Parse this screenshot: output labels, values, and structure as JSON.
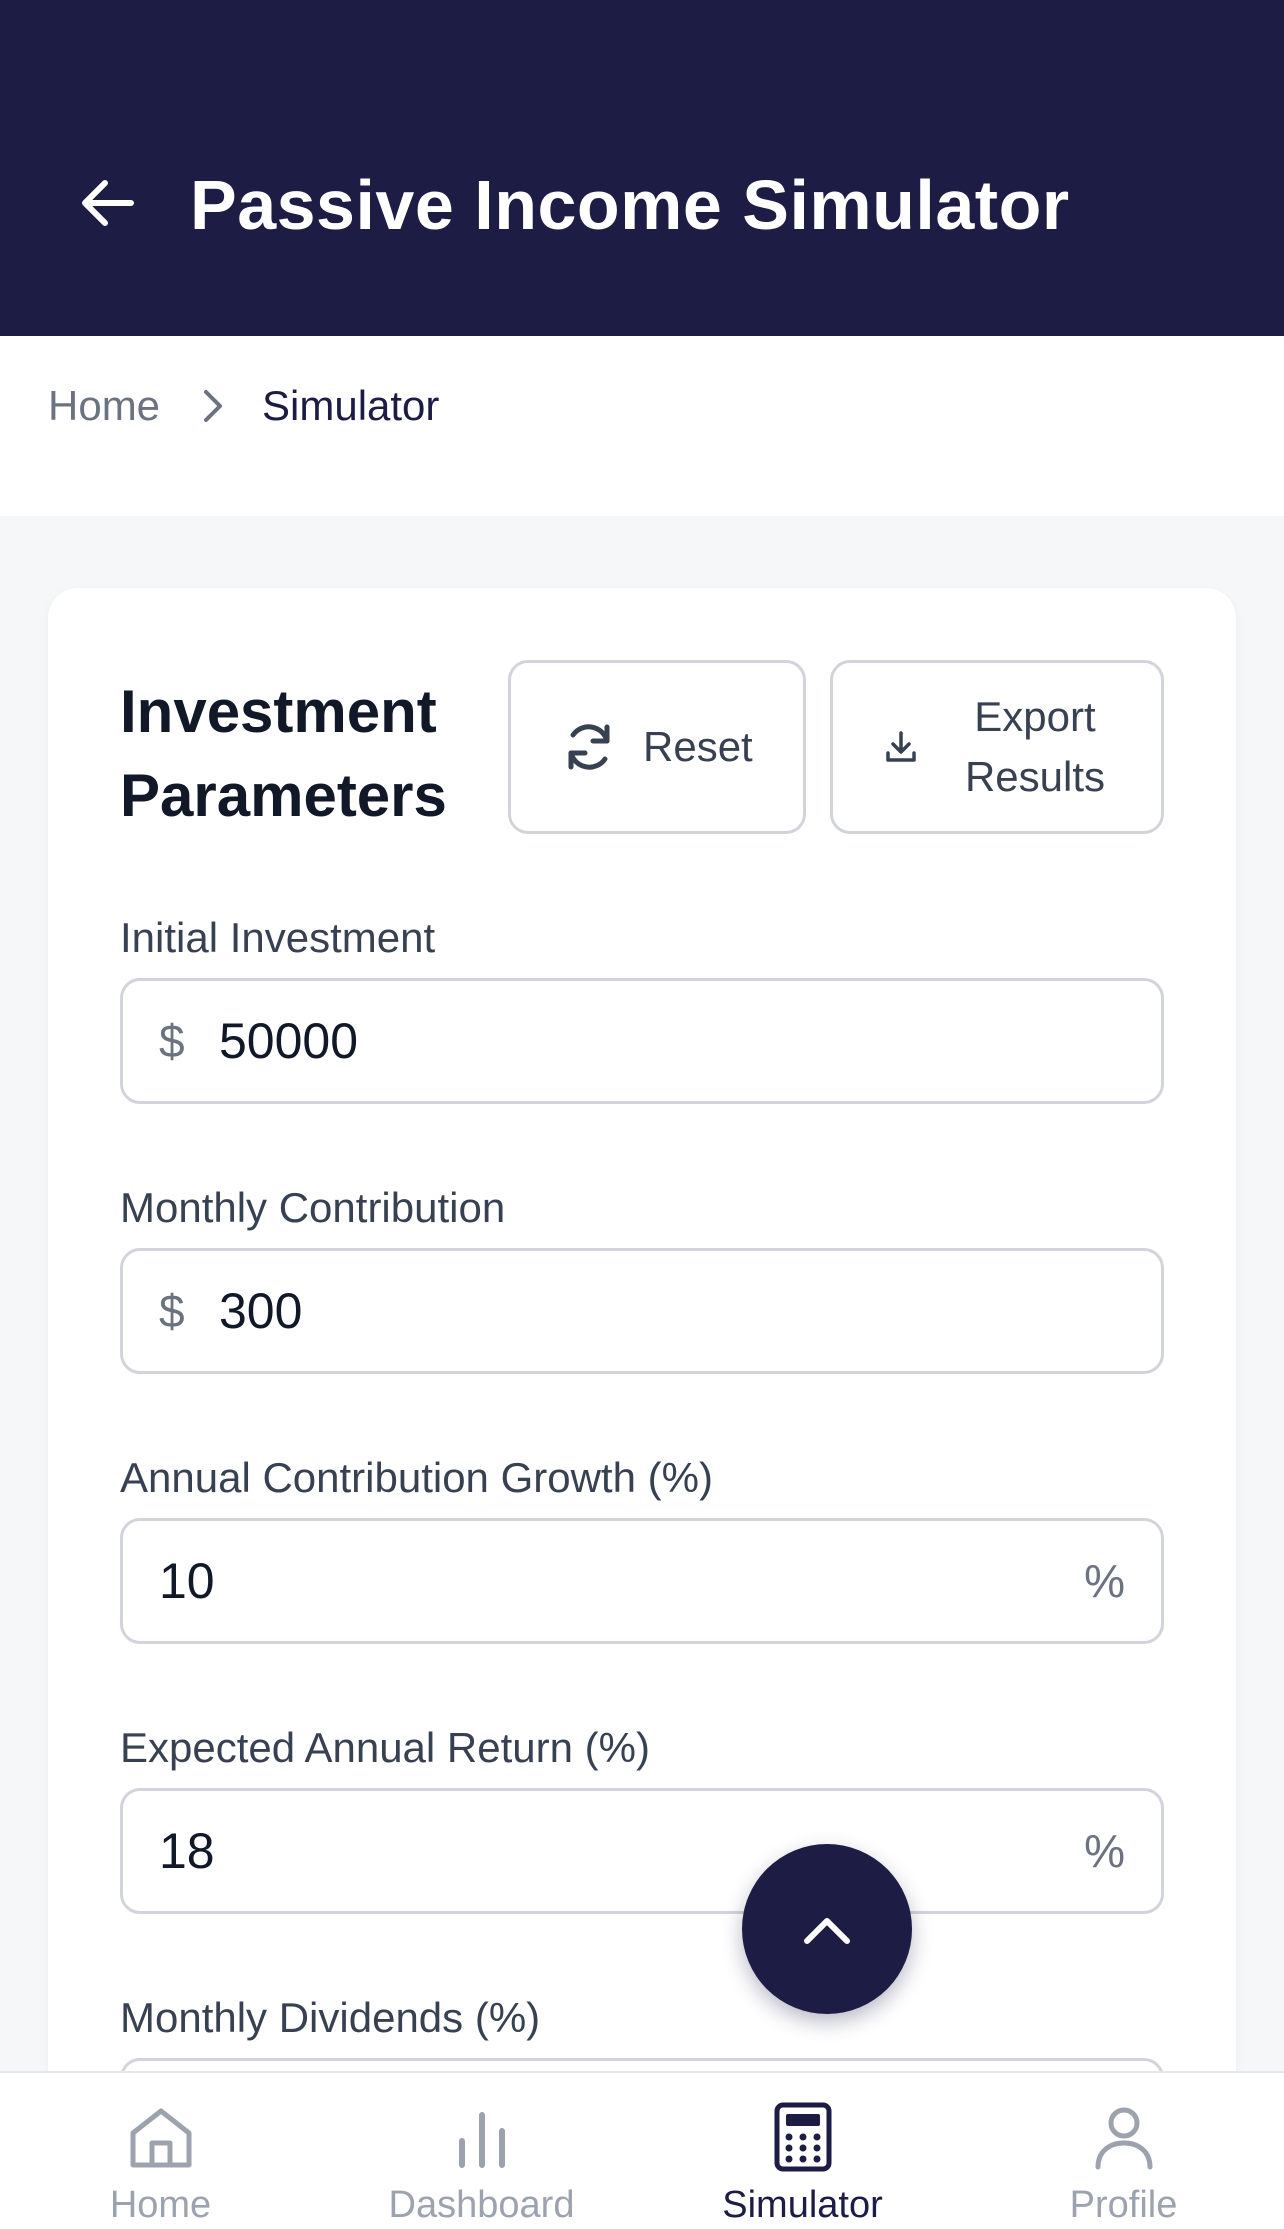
{
  "header": {
    "title": "Passive Income Simulator"
  },
  "breadcrumb": {
    "home": "Home",
    "current": "Simulator"
  },
  "card": {
    "title": "Investment Parameters",
    "reset_label": "Reset",
    "export_label": "Export Results"
  },
  "fields": {
    "initial_investment": {
      "label": "Initial Investment",
      "prefix": "$",
      "value": "50000"
    },
    "monthly_contribution": {
      "label": "Monthly Contribution",
      "prefix": "$",
      "value": "300"
    },
    "annual_growth": {
      "label": "Annual Contribution Growth (%)",
      "suffix": "%",
      "value": "10"
    },
    "annual_return": {
      "label": "Expected Annual Return (%)",
      "suffix": "%",
      "value": "18"
    },
    "monthly_dividends": {
      "label": "Monthly Dividends (%)"
    }
  },
  "bottom_nav": {
    "items": [
      {
        "label": "Home",
        "icon": "home-icon"
      },
      {
        "label": "Dashboard",
        "icon": "bar-chart-icon"
      },
      {
        "label": "Simulator",
        "icon": "calculator-icon",
        "active": true
      },
      {
        "label": "Profile",
        "icon": "user-icon"
      }
    ]
  },
  "colors": {
    "primary": "#1c1c44",
    "muted": "#9ca3af",
    "border": "#d1d5db",
    "background": "#f6f7f9"
  }
}
